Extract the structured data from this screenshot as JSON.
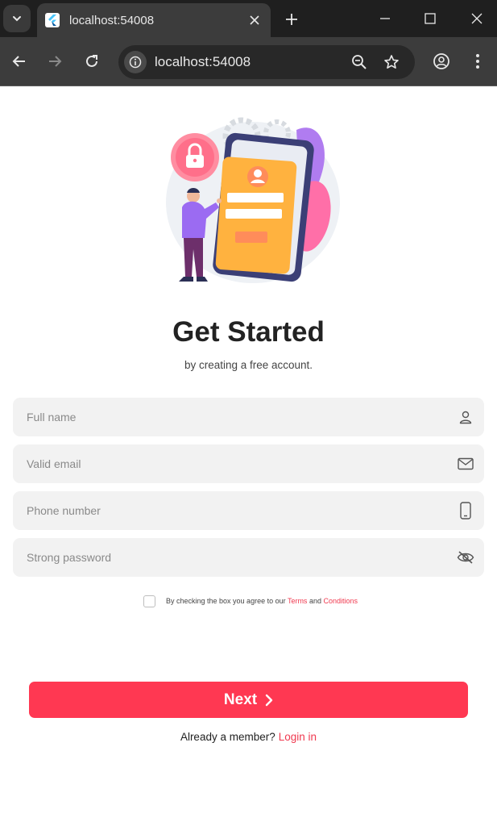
{
  "browser": {
    "tab_title": "localhost:54008",
    "url": "localhost:54008"
  },
  "page": {
    "title": "Get Started",
    "subtitle": "by creating a free account.",
    "fields": {
      "full_name": {
        "placeholder": "Full name",
        "icon": "user-icon"
      },
      "email": {
        "placeholder": "Valid email",
        "icon": "mail-icon"
      },
      "phone": {
        "placeholder": "Phone number",
        "icon": "phone-icon"
      },
      "password": {
        "placeholder": "Strong password",
        "icon": "eye-off-icon"
      }
    },
    "terms": {
      "prefix": "By checking the box you agree to our",
      "terms_link": "Terms",
      "and": "and",
      "conditions_link": "Conditions"
    },
    "next_label": "Next",
    "member_text": "Already a member?",
    "login_link": "Login in"
  },
  "colors": {
    "accent": "#ff3852",
    "field_bg": "#f2f2f2"
  }
}
